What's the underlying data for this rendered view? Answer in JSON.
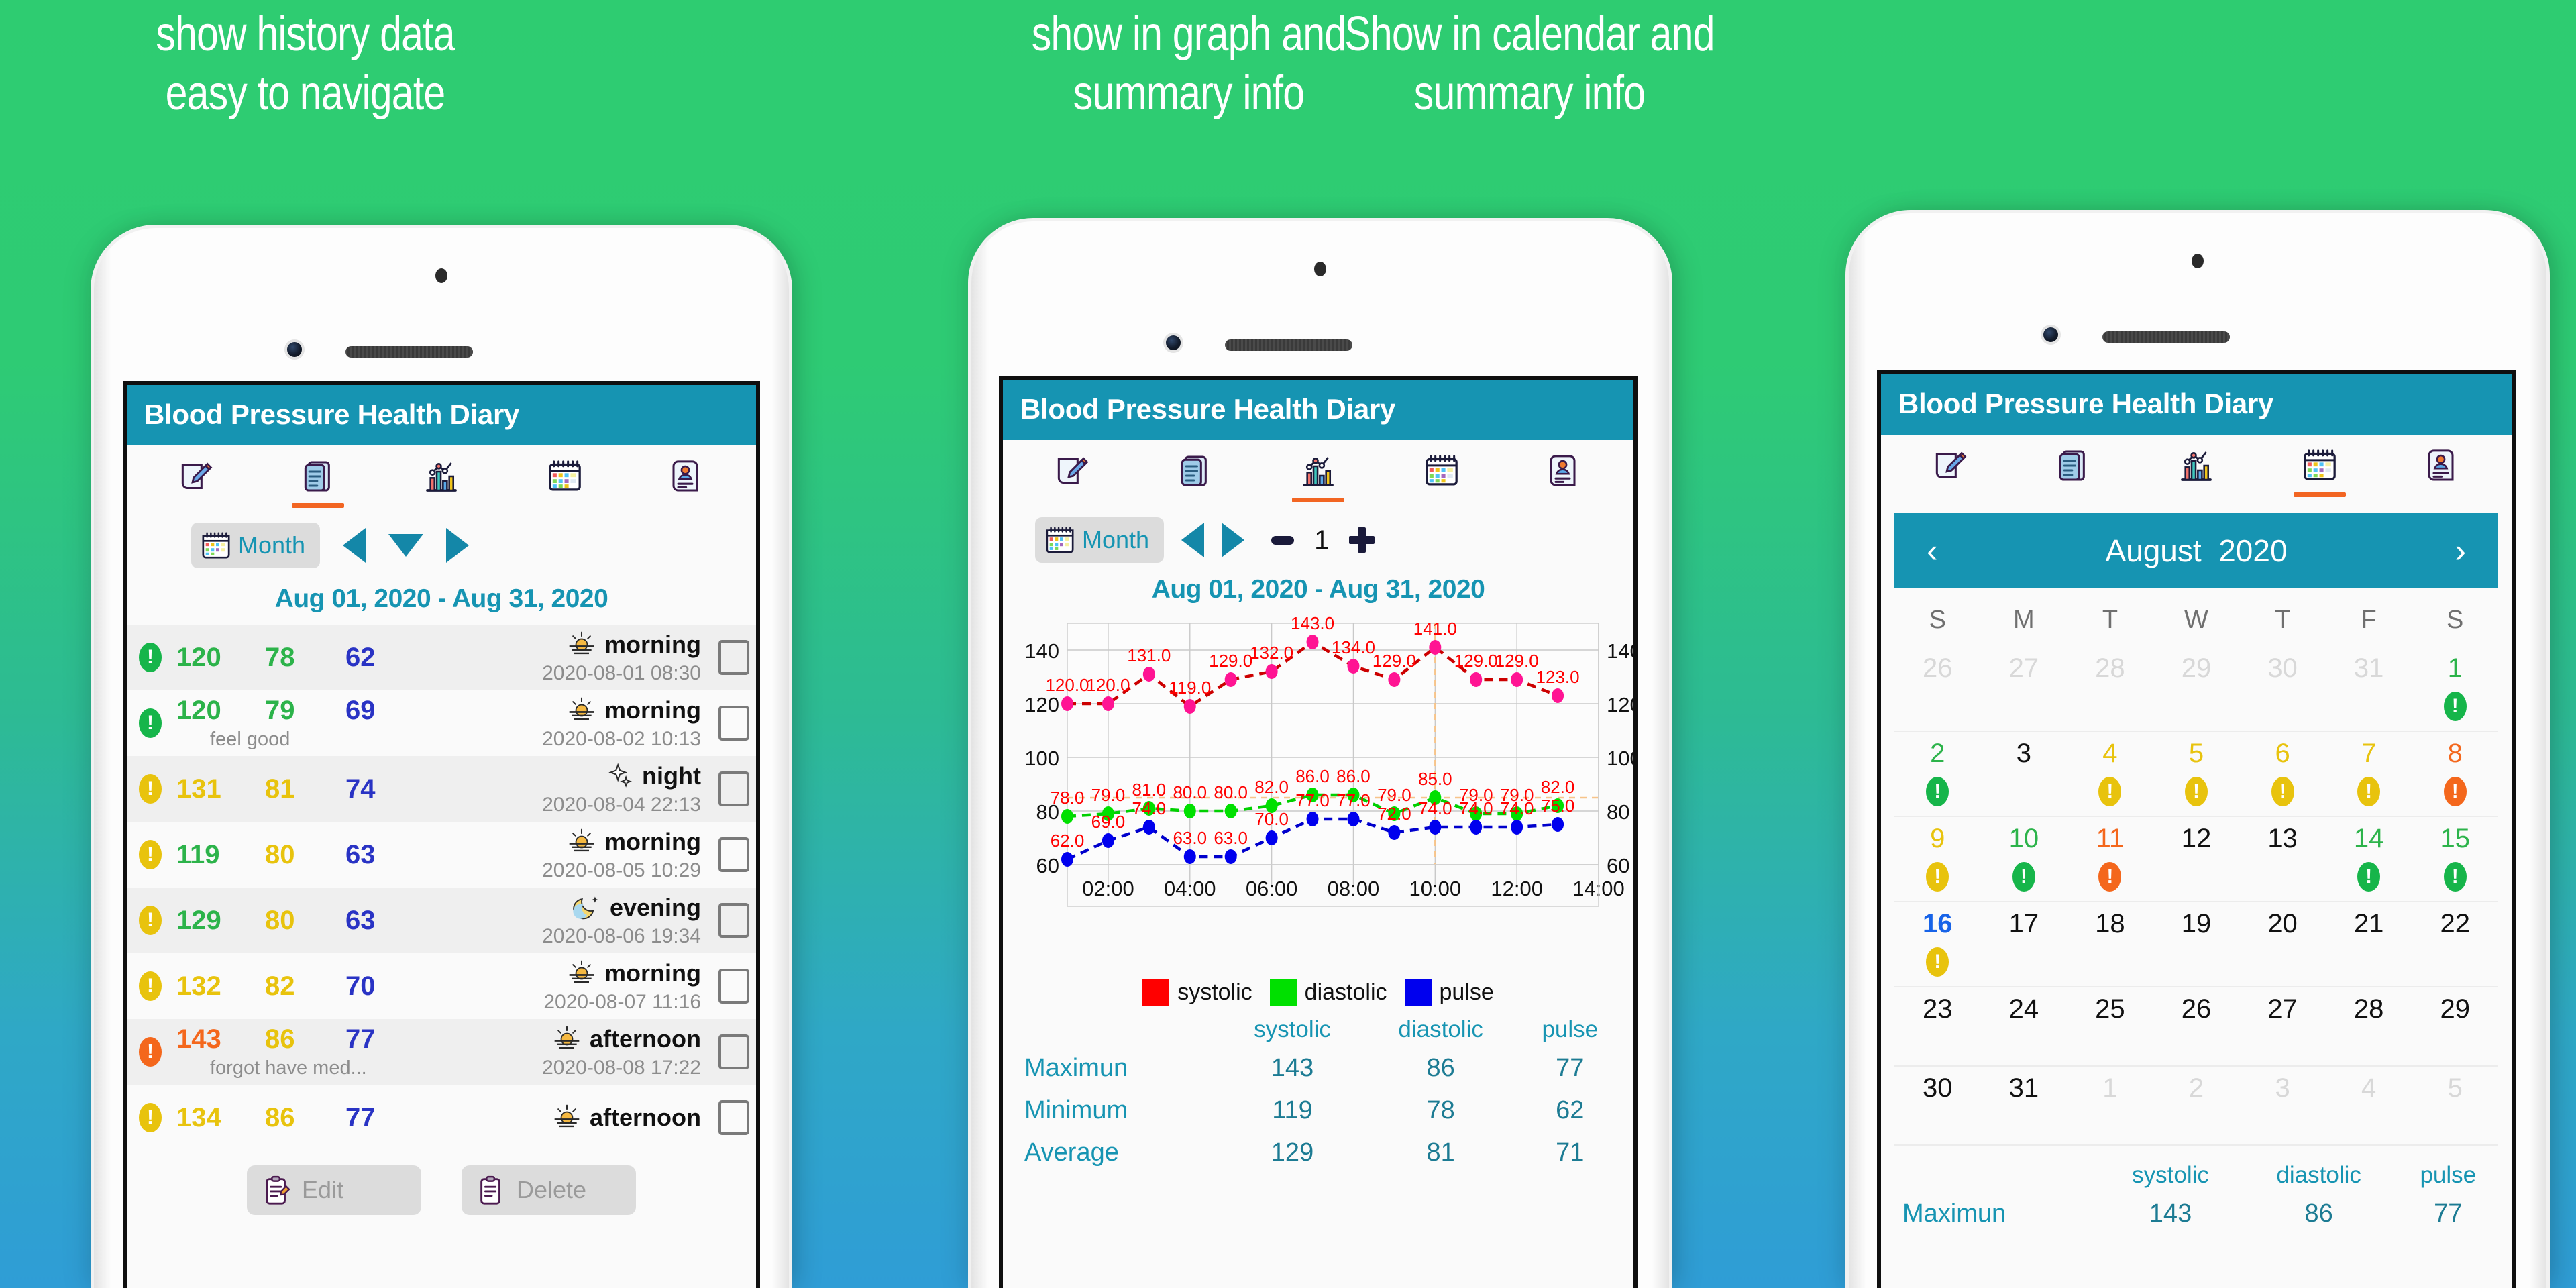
{
  "captions": {
    "c1": "show history data\neasy to navigate",
    "c2": "show in graph and\nsummary info",
    "c3": "Show in calendar and\nsummary info"
  },
  "app": {
    "title": "Blood Pressure Health Diary",
    "accent": "#1694B2",
    "tab_underline": "#F26522",
    "tabs": [
      {
        "icon": "edit-note-icon",
        "name": "tab-entry"
      },
      {
        "icon": "list-records-icon",
        "name": "tab-history"
      },
      {
        "icon": "bar-chart-icon",
        "name": "tab-graph"
      },
      {
        "icon": "calendar-icon",
        "name": "tab-calendar"
      },
      {
        "icon": "profile-card-icon",
        "name": "tab-profile"
      }
    ]
  },
  "screen1": {
    "active_tab": 1,
    "period_button": "Month",
    "range": "Aug 01, 2020  -  Aug 31, 2020",
    "rows": [
      {
        "level": "green",
        "sys": "120",
        "dia": "78",
        "pulse": "62",
        "note": "",
        "period": "morning",
        "period_icon": "sunrise-icon",
        "date": "2020-08-01 08:30",
        "sys_color": "#2CB34A",
        "dia_color": "#2CB34A"
      },
      {
        "level": "green",
        "sys": "120",
        "dia": "79",
        "pulse": "69",
        "note": "feel good",
        "period": "morning",
        "period_icon": "sunrise-icon",
        "date": "2020-08-02 10:13",
        "sys_color": "#2CB34A",
        "dia_color": "#2CB34A"
      },
      {
        "level": "yellow",
        "sys": "131",
        "dia": "81",
        "pulse": "74",
        "note": "",
        "period": "night",
        "period_icon": "sparkle-night-icon",
        "date": "2020-08-04 22:13",
        "sys_color": "#E8C30D",
        "dia_color": "#E8C30D"
      },
      {
        "level": "yellow",
        "sys": "119",
        "dia": "80",
        "pulse": "63",
        "note": "",
        "period": "morning",
        "period_icon": "sunrise-icon",
        "date": "2020-08-05 10:29",
        "sys_color": "#2CB34A",
        "dia_color": "#E8C30D"
      },
      {
        "level": "yellow",
        "sys": "129",
        "dia": "80",
        "pulse": "63",
        "note": "",
        "period": "evening",
        "period_icon": "moon-icon",
        "date": "2020-08-06 19:34",
        "sys_color": "#2CB34A",
        "dia_color": "#E8C30D"
      },
      {
        "level": "yellow",
        "sys": "132",
        "dia": "82",
        "pulse": "70",
        "note": "",
        "period": "morning",
        "period_icon": "sunrise-icon",
        "date": "2020-08-07 11:16",
        "sys_color": "#E8C30D",
        "dia_color": "#E8C30D"
      },
      {
        "level": "orange",
        "sys": "143",
        "dia": "86",
        "pulse": "77",
        "note": "forgot have med...",
        "period": "afternoon",
        "period_icon": "sunrise-icon",
        "date": "2020-08-08 17:22",
        "sys_color": "#F4671C",
        "dia_color": "#E8C30D"
      },
      {
        "level": "yellow",
        "sys": "134",
        "dia": "86",
        "pulse": "77",
        "note": "",
        "period": "afternoon",
        "period_icon": "sunrise-icon",
        "date": "",
        "sys_color": "#E8C30D",
        "dia_color": "#E8C30D"
      }
    ],
    "edit_label": "Edit",
    "delete_label": "Delete"
  },
  "screen2": {
    "active_tab": 2,
    "period_button": "Month",
    "zoom_value": "1",
    "range": "Aug 01, 2020  -  Aug 31, 2020",
    "summary": {
      "columns": [
        "systolic",
        "diastolic",
        "pulse"
      ],
      "rows": [
        {
          "label": "Maximun",
          "values": [
            "143",
            "86",
            "77"
          ]
        },
        {
          "label": "Minimum",
          "values": [
            "119",
            "78",
            "62"
          ]
        },
        {
          "label": "Average",
          "values": [
            "129",
            "81",
            "71"
          ]
        }
      ]
    }
  },
  "screen3": {
    "active_tab": 3,
    "calendar": {
      "month": "August",
      "year": "2020",
      "prev_icon": "chevron-left-icon",
      "next_icon": "chevron-right-icon",
      "dow": [
        "S",
        "M",
        "T",
        "W",
        "T",
        "F",
        "S"
      ],
      "weeks": [
        [
          {
            "d": "26",
            "muted": true
          },
          {
            "d": "27",
            "muted": true
          },
          {
            "d": "28",
            "muted": true
          },
          {
            "d": "29",
            "muted": true
          },
          {
            "d": "30",
            "muted": true
          },
          {
            "d": "31",
            "muted": true
          },
          {
            "d": "1",
            "color": "#2CB34A",
            "badge": "green"
          }
        ],
        [
          {
            "d": "2",
            "color": "#2CB34A",
            "badge": "green"
          },
          {
            "d": "3",
            "color": "#111111"
          },
          {
            "d": "4",
            "color": "#E8C30D",
            "badge": "yellow"
          },
          {
            "d": "5",
            "color": "#E8C30D",
            "badge": "yellow"
          },
          {
            "d": "6",
            "color": "#E8C30D",
            "badge": "yellow"
          },
          {
            "d": "7",
            "color": "#E8C30D",
            "badge": "yellow"
          },
          {
            "d": "8",
            "color": "#F4671C",
            "badge": "orange"
          }
        ],
        [
          {
            "d": "9",
            "color": "#E8C30D",
            "badge": "yellow"
          },
          {
            "d": "10",
            "color": "#2CB34A",
            "badge": "green"
          },
          {
            "d": "11",
            "color": "#F4671C",
            "badge": "orange"
          },
          {
            "d": "12",
            "color": "#111111"
          },
          {
            "d": "13",
            "color": "#111111"
          },
          {
            "d": "14",
            "color": "#2CB34A",
            "badge": "green"
          },
          {
            "d": "15",
            "color": "#2CB34A",
            "badge": "green"
          }
        ],
        [
          {
            "d": "16",
            "color": "#1763E8",
            "badge": "yellow"
          },
          {
            "d": "17",
            "color": "#111111"
          },
          {
            "d": "18",
            "color": "#111111"
          },
          {
            "d": "19",
            "color": "#111111"
          },
          {
            "d": "20",
            "color": "#111111"
          },
          {
            "d": "21",
            "color": "#111111"
          },
          {
            "d": "22",
            "color": "#111111"
          }
        ],
        [
          {
            "d": "23",
            "color": "#111111"
          },
          {
            "d": "24",
            "color": "#111111"
          },
          {
            "d": "25",
            "color": "#111111"
          },
          {
            "d": "26",
            "color": "#111111"
          },
          {
            "d": "27",
            "color": "#111111"
          },
          {
            "d": "28",
            "color": "#111111"
          },
          {
            "d": "29",
            "color": "#111111"
          }
        ],
        [
          {
            "d": "30",
            "color": "#111111"
          },
          {
            "d": "31",
            "color": "#111111"
          },
          {
            "d": "1",
            "muted": true
          },
          {
            "d": "2",
            "muted": true
          },
          {
            "d": "3",
            "muted": true
          },
          {
            "d": "4",
            "muted": true
          },
          {
            "d": "5",
            "muted": true
          }
        ]
      ]
    },
    "summary": {
      "columns": [
        "systolic",
        "diastolic",
        "pulse"
      ],
      "rows": [
        {
          "label": "Maximun",
          "values": [
            "143",
            "86",
            "77"
          ]
        }
      ]
    }
  },
  "chart_data": {
    "type": "line",
    "title": "",
    "xlabel": "",
    "ylabel": "",
    "ylim": [
      60,
      150
    ],
    "yticks": [
      60,
      80,
      100,
      120,
      140
    ],
    "xticks": [
      "02:00",
      "04:00",
      "06:00",
      "08:00",
      "10:00",
      "12:00",
      "14:00"
    ],
    "grid": true,
    "legend_position": "bottom",
    "x": [
      1,
      2,
      3,
      4,
      5,
      6,
      7,
      8,
      9,
      10,
      11,
      12,
      13,
      14
    ],
    "series": [
      {
        "name": "systolic",
        "color": "#FF1493",
        "line_color": "#CC0000",
        "label_color": "#FF0000",
        "values": [
          120.0,
          120.0,
          131.0,
          119.0,
          129.0,
          132.0,
          143.0,
          134.0,
          129.0,
          141.0,
          129.0,
          129.0,
          123.0,
          null
        ],
        "labels": [
          "120.0",
          "120.0",
          "131.0",
          "119.0",
          "129.0",
          "132.0",
          "143.0",
          "134.0",
          "129.0",
          "141.0",
          "129.0",
          "129.0",
          "123.0",
          ""
        ]
      },
      {
        "name": "diastolic",
        "color": "#00E000",
        "line_color": "#00D000",
        "label_color": "#FF0000",
        "values": [
          78.0,
          79.0,
          81.0,
          80.0,
          80.0,
          82.0,
          86.0,
          86.0,
          79.0,
          85.0,
          79.0,
          79.0,
          82.0,
          null
        ],
        "labels": [
          "78.0",
          "79.0",
          "81.0",
          "80.0",
          "80.0",
          "82.0",
          "86.0",
          "86.0",
          "79.0",
          "85.0",
          "79.0",
          "79.0",
          "82.0",
          ""
        ]
      },
      {
        "name": "pulse",
        "color": "#0000EE",
        "line_color": "#0000CC",
        "label_color": "#FF0000",
        "values": [
          62.0,
          69.0,
          74.0,
          63.0,
          63.0,
          70.0,
          77.0,
          77.0,
          72.0,
          74.0,
          74.0,
          74.0,
          75.0,
          null
        ],
        "labels": [
          "62.0",
          "69.0",
          "74.0",
          "63.0",
          "63.0",
          "70.0",
          "77.0",
          "77.0",
          "72.0",
          "74.0",
          "74.0",
          "74.0",
          "75.0",
          ""
        ]
      }
    ],
    "crosshair": {
      "x_index": 10,
      "y_value": 85,
      "color": "#F7C48A"
    },
    "legend": [
      {
        "label": "systolic",
        "color": "#FF0000"
      },
      {
        "label": "diastolic",
        "color": "#00E000"
      },
      {
        "label": "pulse",
        "color": "#0000EE"
      }
    ]
  }
}
